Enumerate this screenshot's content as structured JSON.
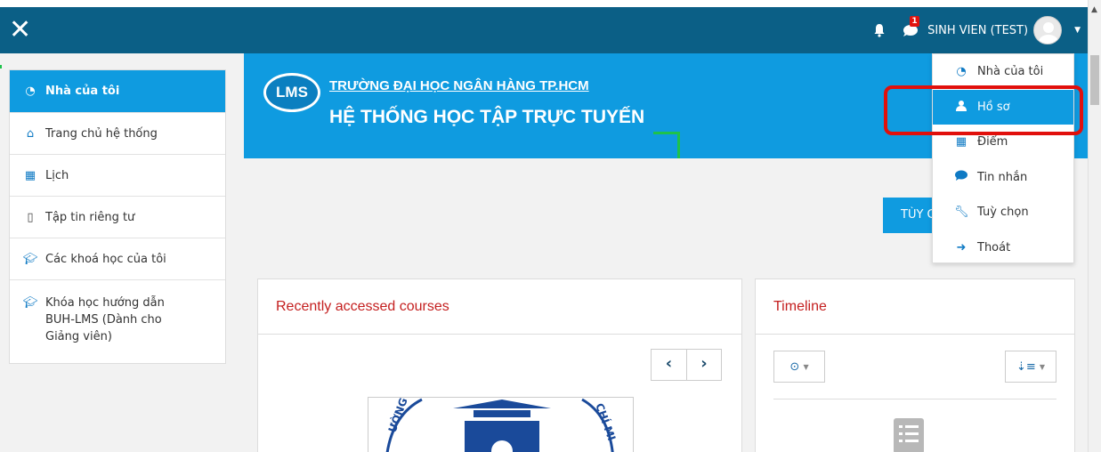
{
  "navbar": {
    "close_icon": "✕",
    "message_badge": "1",
    "username": "SINH VIEN (TEST)"
  },
  "drawer": {
    "items": [
      {
        "label": "Nhà của tôi",
        "icon": "dashboard-icon"
      },
      {
        "label": "Trang chủ hệ thống",
        "icon": "home-icon"
      },
      {
        "label": "Lịch",
        "icon": "calendar-icon"
      },
      {
        "label": "Tập tin riêng tư",
        "icon": "file-icon"
      },
      {
        "label": "Các khoá học của tôi",
        "icon": "graduation-cap-icon"
      },
      {
        "label": "Khóa học hướng dẫn BUH-LMS (Dành cho Giảng viên)",
        "icon": "graduation-cap-icon"
      }
    ]
  },
  "banner": {
    "logo_text": "LMS",
    "line1": "TRƯỜNG ĐẠI HỌC NGÂN HÀNG TP.HCM",
    "line2": "HỆ THỐNG HỌC TẬP TRỰC TUYẾN"
  },
  "customize_button": "TÙY CHỈNH TRANG NÀY",
  "cards": {
    "recent": {
      "title": "Recently accessed courses"
    },
    "timeline": {
      "title": "Timeline"
    }
  },
  "user_menu": {
    "items": [
      {
        "label": "Nhà của tôi",
        "icon": "dashboard-icon"
      },
      {
        "label": "Hồ sơ",
        "icon": "user-icon"
      },
      {
        "label": "Điểm",
        "icon": "table-icon"
      },
      {
        "label": "Tin nhắn",
        "icon": "comment-icon"
      },
      {
        "label": "Tuỳ chọn",
        "icon": "wrench-icon"
      },
      {
        "label": "Thoát",
        "icon": "sign-out-icon"
      }
    ],
    "active_index": 1
  },
  "colors": {
    "navbar": "#0b5f86",
    "accent": "#0f9be0",
    "card_title": "#c41f1f",
    "highlight": "#e1100c"
  }
}
